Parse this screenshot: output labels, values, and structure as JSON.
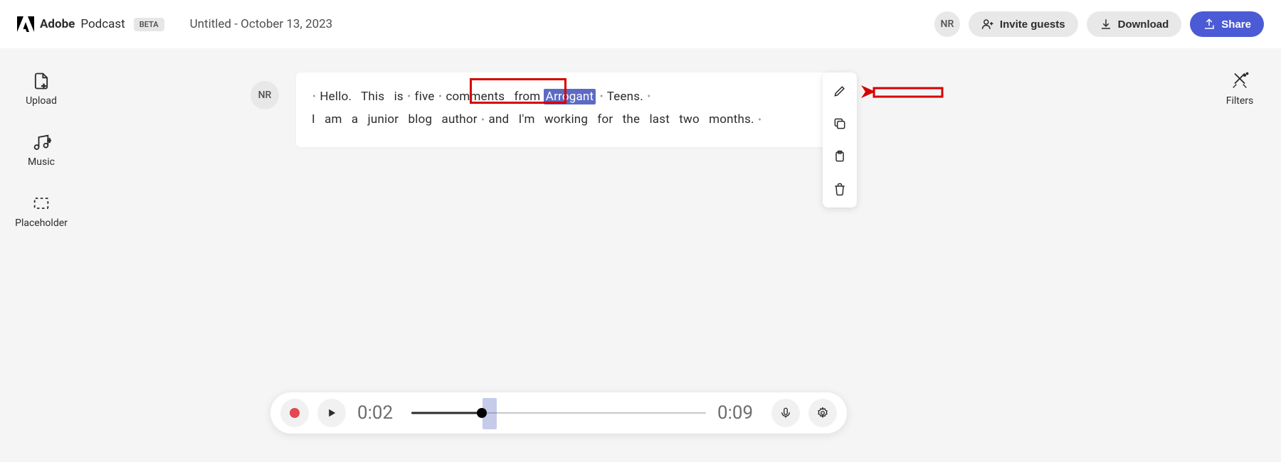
{
  "header": {
    "brand_bold": "Adobe",
    "brand_regular": "Podcast",
    "beta": "BETA",
    "project_title": "Untitled - October 13, 2023",
    "user_initials": "NR",
    "invite_label": "Invite guests",
    "download_label": "Download",
    "share_label": "Share"
  },
  "left_rail": {
    "upload": "Upload",
    "music": "Music",
    "placeholder": "Placeholder"
  },
  "right_rail": {
    "filters": "Filters"
  },
  "transcript": {
    "speaker_initials": "NR",
    "line1": {
      "w0": "Hello.",
      "w1": "This",
      "w2": "is",
      "w3": "five",
      "w4": "comments",
      "w5": "from",
      "w6": "Arrogant",
      "w7": "Teens."
    },
    "line2": {
      "w0": "I",
      "w1": "am",
      "w2": "a",
      "w3": "junior",
      "w4": "blog",
      "w5": "author",
      "w6": "and",
      "w7": "I'm",
      "w8": "working",
      "w9": "for",
      "w10": "the",
      "w11": "last",
      "w12": "two",
      "w13": "months."
    }
  },
  "playbar": {
    "current_time": "0:02",
    "total_time": "0:09",
    "progress_percent": 24,
    "selection_percent": 25
  }
}
